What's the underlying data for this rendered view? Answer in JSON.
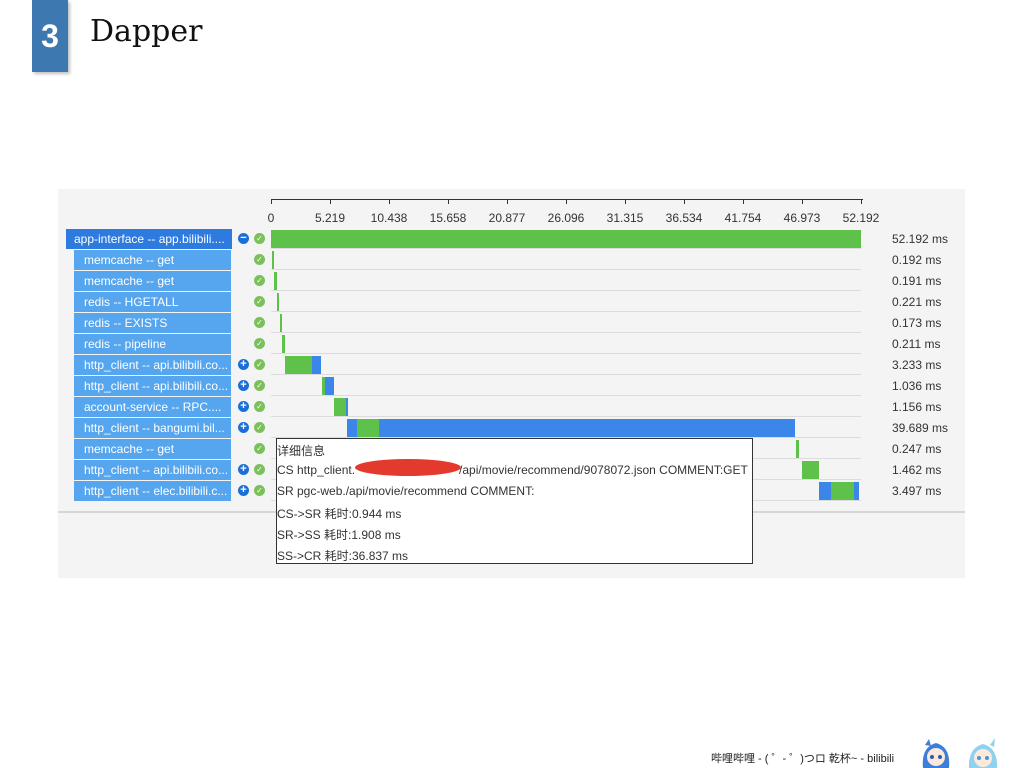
{
  "slide": {
    "number": "3",
    "title": "Dapper"
  },
  "axis": {
    "ticks": [
      "0",
      "5.219",
      "10.438",
      "15.658",
      "20.877",
      "26.096",
      "31.315",
      "36.534",
      "41.754",
      "46.973",
      "52.192"
    ],
    "max_ms": 52.192
  },
  "spans": [
    {
      "name": "app-interface -- app.bilibili....",
      "duration": "52.192 ms",
      "start": 0,
      "control": "collapse",
      "status": "ok",
      "segments": [
        {
          "color": "green",
          "length": 52.192
        }
      ]
    },
    {
      "name": "memcache -- get",
      "duration": "0.192 ms",
      "start": 0.1,
      "control": "",
      "status": "ok",
      "segments": [
        {
          "color": "green",
          "length": 0.192
        }
      ]
    },
    {
      "name": "memcache -- get",
      "duration": "0.191 ms",
      "start": 0.3,
      "control": "",
      "status": "ok",
      "segments": [
        {
          "color": "green",
          "length": 0.191
        }
      ]
    },
    {
      "name": "redis -- HGETALL",
      "duration": "0.221 ms",
      "start": 0.5,
      "control": "",
      "status": "ok",
      "segments": [
        {
          "color": "green",
          "length": 0.221
        }
      ]
    },
    {
      "name": "redis -- EXISTS",
      "duration": "0.173 ms",
      "start": 0.8,
      "control": "",
      "status": "ok",
      "segments": [
        {
          "color": "green",
          "length": 0.173
        }
      ]
    },
    {
      "name": "redis -- pipeline",
      "duration": "0.211 ms",
      "start": 1.0,
      "control": "",
      "status": "ok",
      "segments": [
        {
          "color": "green",
          "length": 0.211
        }
      ]
    },
    {
      "name": "http_client -- api.bilibili.co...",
      "duration": "3.233 ms",
      "start": 1.2,
      "control": "expand",
      "status": "ok",
      "segments": [
        {
          "color": "green",
          "length": 2.4
        },
        {
          "color": "blue",
          "length": 0.833
        }
      ]
    },
    {
      "name": "http_client -- api.bilibili.co...",
      "duration": "1.036 ms",
      "start": 4.5,
      "control": "expand",
      "status": "ok",
      "segments": [
        {
          "color": "green",
          "length": 0.25
        },
        {
          "color": "blue",
          "length": 0.786
        }
      ]
    },
    {
      "name": "account-service -- RPC....",
      "duration": "1.156 ms",
      "start": 5.6,
      "control": "expand",
      "status": "ok",
      "segments": [
        {
          "color": "green",
          "length": 1.0
        },
        {
          "color": "blue",
          "length": 0.156
        }
      ]
    },
    {
      "name": "http_client -- bangumi.bil...",
      "duration": "39.689 ms",
      "start": 6.7,
      "control": "expand",
      "status": "ok",
      "segments": [
        {
          "color": "blue",
          "length": 0.944
        },
        {
          "color": "green",
          "length": 1.908
        },
        {
          "color": "blue",
          "length": 36.837
        }
      ]
    },
    {
      "name": "memcache -- get",
      "duration": "0.247 ms",
      "start": 46.45,
      "control": "",
      "status": "ok",
      "segments": [
        {
          "color": "green",
          "length": 0.247
        }
      ]
    },
    {
      "name": "http_client -- api.bilibili.co...",
      "duration": "1.462 ms",
      "start": 47.0,
      "control": "expand",
      "status": "ok",
      "segments": [
        {
          "color": "green",
          "length": 1.462
        }
      ]
    },
    {
      "name": "http_client -- elec.bilibili.c...",
      "duration": "3.497 ms",
      "start": 48.5,
      "control": "expand",
      "status": "ok",
      "segments": [
        {
          "color": "blue",
          "length": 1.0
        },
        {
          "color": "green",
          "length": 2.1
        },
        {
          "color": "blue",
          "length": 0.397
        }
      ]
    }
  ],
  "tooltip": {
    "title": "详细信息",
    "cs_prefix": "CS http_client.",
    "cs_suffix": "/api/movie/recommend/9078072.json COMMENT:GET",
    "sr": "SR pgc-web./api/movie/recommend COMMENT:",
    "cs_sr": "CS->SR 耗时:0.944 ms",
    "sr_ss": "SR->SS 耗时:1.908 ms",
    "ss_cr": "SS->CR 耗时:36.837 ms"
  },
  "footer": {
    "text": "哔哩哔哩 - ( ゜- ゜)つロ 乾杯~ - bilibili"
  },
  "colors": {
    "green": "#5ec14a",
    "blue": "#3b86e8",
    "root_label": "#2e7be0",
    "child_label": "#55a6ef",
    "ok": "#7cc05b",
    "redaction": "#e43a2e"
  }
}
